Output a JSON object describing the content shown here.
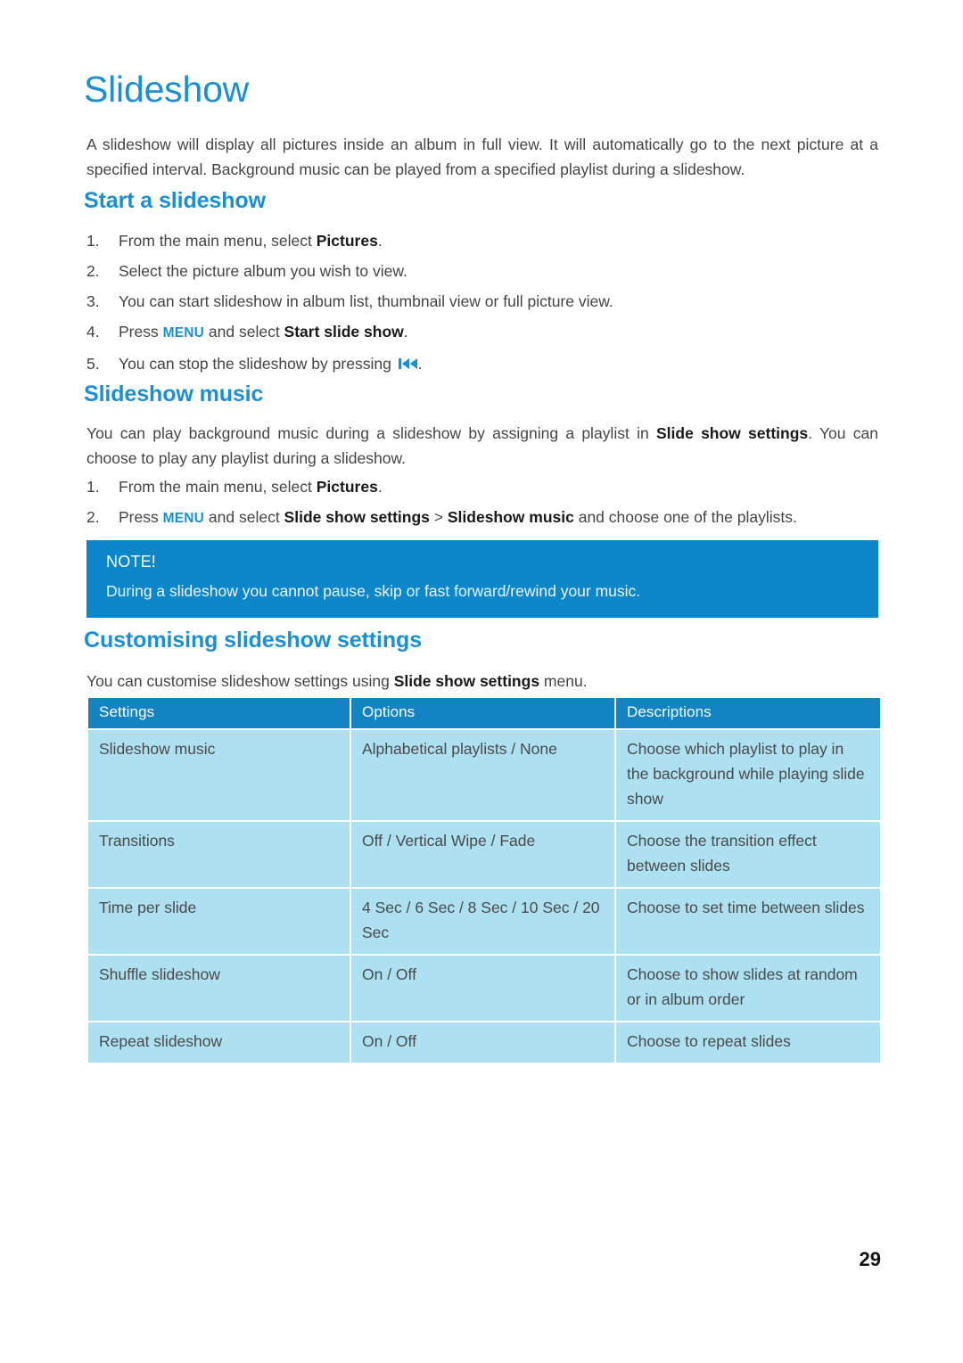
{
  "document": {
    "title": "Slideshow",
    "page_number": "29",
    "accent_color": "#1b8fd4",
    "note_bg_color": "#0d87ca",
    "table_header_color": "#1383c4",
    "table_cell_color": "#ade0f1"
  },
  "intro": {
    "paragraph": "A slideshow will display all pictures inside an album in full view. It will automatically go to the next picture at a specified interval. Background music can be played from a specified playlist during a slideshow."
  },
  "start_section": {
    "heading": "Start a slideshow",
    "steps": [
      {
        "num": "1.",
        "pre": "From the main menu, select ",
        "bold": "Pictures",
        "post": "."
      },
      {
        "num": "2.",
        "pre": "Select the picture album you wish to view.",
        "bold": "",
        "post": ""
      },
      {
        "num": "3.",
        "pre": "You can start slideshow in album list, thumbnail view or full picture view.",
        "bold": "",
        "post": ""
      },
      {
        "num": "4.",
        "pre": "Press ",
        "key": "MENU",
        "mid": " and select ",
        "bold": "Start slide show",
        "post": "."
      },
      {
        "num": "5.",
        "pre": "You can stop the slideshow by pressing ",
        "icon": "skip-back-icon",
        "post": "."
      }
    ]
  },
  "music_section": {
    "heading": "Slideshow music",
    "paragraph_pre": "You can play background music during a slideshow by assigning a playlist in ",
    "paragraph_bold": "Slide show settings",
    "paragraph_post": ". You can choose to play any playlist during a slideshow.",
    "steps": [
      {
        "num": "1.",
        "pre": "From the main menu, select ",
        "bold": "Pictures",
        "post": "."
      },
      {
        "num": "2.",
        "pre": "Press ",
        "key": "MENU",
        "mid": " and select ",
        "bold": "Slide show settings",
        "sep": " > ",
        "bold2": "Slideshow music",
        "post": " and choose one of the playlists."
      }
    ]
  },
  "note": {
    "title": "NOTE!",
    "body": "During a slideshow you cannot pause, skip or fast forward/rewind your music."
  },
  "customise_section": {
    "heading": "Customising slideshow settings",
    "paragraph_pre": "You can customise slideshow settings using ",
    "paragraph_bold": "Slide show settings",
    "paragraph_post": " menu."
  },
  "settings_table": {
    "headers": [
      "Settings",
      "Options",
      "Descriptions"
    ],
    "rows": [
      {
        "setting": "Slideshow music",
        "options": "Alphabetical playlists / None",
        "description": "Choose which playlist to play in the background while playing slide show"
      },
      {
        "setting": "Transitions",
        "options": "Off / Vertical Wipe / Fade",
        "description": "Choose the transition effect between slides"
      },
      {
        "setting": "Time per slide",
        "options": "4 Sec / 6 Sec / 8 Sec / 10 Sec / 20 Sec",
        "description": "Choose to set time between slides"
      },
      {
        "setting": "Shuffle slideshow",
        "options": "On / Off",
        "description": "Choose to show slides at random or in album order"
      },
      {
        "setting": "Repeat slideshow",
        "options": "On / Off",
        "description": "Choose to repeat slides"
      }
    ]
  }
}
